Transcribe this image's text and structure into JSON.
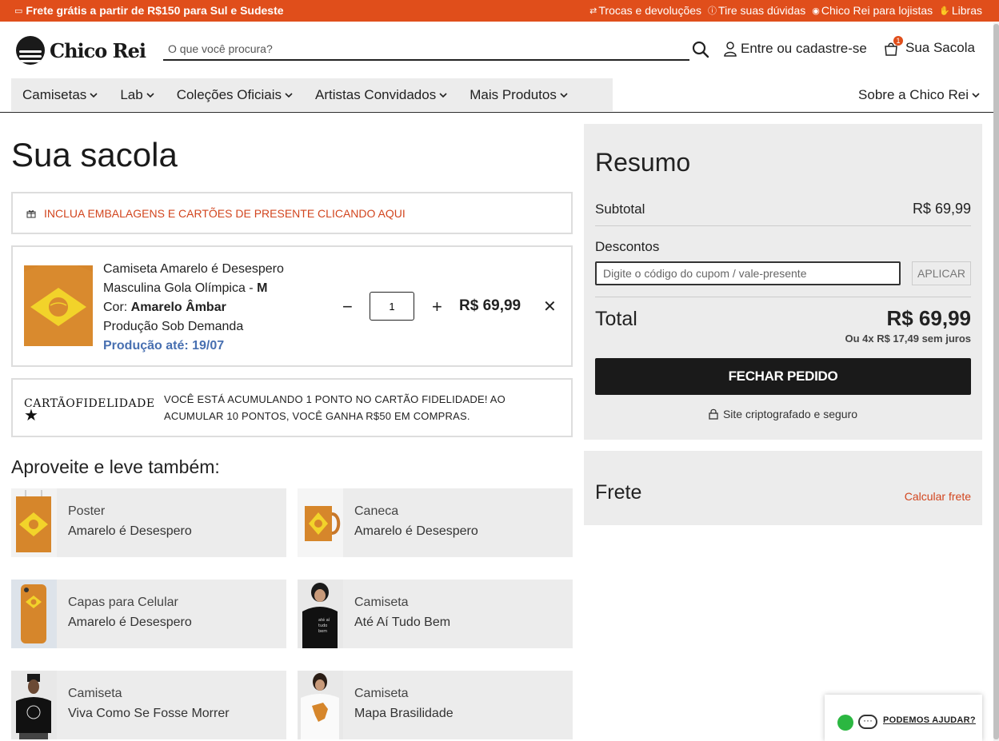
{
  "topbar": {
    "promo": "Frete grátis a partir de R$150 para Sul e Sudeste",
    "links": [
      "Trocas e devoluções",
      "Tire suas dúvidas",
      "Chico Rei para lojistas",
      "Libras"
    ]
  },
  "brand": {
    "name": "Chico Rei"
  },
  "search": {
    "placeholder": "O que você procura?"
  },
  "account": {
    "login_label": "Entre ou cadastre-se",
    "bag_label": "Sua Sacola",
    "bag_count": "1"
  },
  "nav": {
    "items": [
      "Camisetas",
      "Lab",
      "Coleções Oficiais",
      "Artistas Convidados",
      "Mais Produtos"
    ],
    "about": "Sobre a Chico Rei"
  },
  "cart": {
    "title": "Sua sacola",
    "gift_label": "INCLUA EMBALAGENS E CARTÕES DE PRESENTE CLICANDO AQUI",
    "item": {
      "name": "Camiseta Amarelo é Desespero",
      "model_prefix": "Masculina Gola Olímpica - ",
      "size": "M",
      "color_prefix": "Cor: ",
      "color": "Amarelo Âmbar",
      "production": "Produção Sob Demanda",
      "production_date": "Produção até: 19/07",
      "quantity": "1",
      "price": "R$ 69,99"
    },
    "loyalty": {
      "logo_text": "CARTÃOFIDELIDADE",
      "message": "VOCÊ ESTÁ ACUMULANDO 1 PONTO NO CARTÃO FIDELIDADE! AO ACUMULAR 10 PONTOS, VOCÊ GANHA R$50 EM COMPRAS."
    }
  },
  "upsell": {
    "title": "Aproveite e leve também:",
    "items": [
      {
        "category": "Poster",
        "name": "Amarelo é Desespero"
      },
      {
        "category": "Caneca",
        "name": "Amarelo é Desespero"
      },
      {
        "category": "Capas para Celular",
        "name": "Amarelo é Desespero"
      },
      {
        "category": "Camiseta",
        "name": "Até Aí Tudo Bem"
      },
      {
        "category": "Camiseta",
        "name": "Viva Como Se Fosse Morrer"
      },
      {
        "category": "Camiseta",
        "name": "Mapa Brasilidade"
      }
    ]
  },
  "summary": {
    "title": "Resumo",
    "subtotal_label": "Subtotal",
    "subtotal_value": "R$ 69,99",
    "discounts_label": "Descontos",
    "coupon_placeholder": "Digite o código do cupom / vale-presente",
    "apply_label": "APLICAR",
    "total_label": "Total",
    "total_value": "R$ 69,99",
    "installments": "Ou 4x R$ 17,49 sem juros",
    "checkout_label": "FECHAR PEDIDO",
    "secure_label": "Site criptografado e seguro"
  },
  "shipping": {
    "title": "Frete",
    "calc_label": "Calcular frete"
  },
  "help": {
    "label": "PODEMOS AJUDAR?"
  },
  "colors": {
    "accent": "#e04e1b",
    "link_blue": "#4870b1",
    "panel_bg": "#ececec",
    "product_orange": "#d6862b",
    "flag_yellow": "#f2d32a"
  }
}
